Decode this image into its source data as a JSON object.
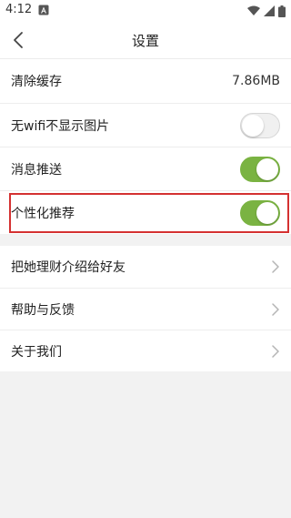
{
  "status_bar": {
    "time": "4:12"
  },
  "header": {
    "title": "设置"
  },
  "settings": {
    "cache": {
      "label": "清除缓存",
      "value": "7.86MB"
    },
    "no_wifi_images": {
      "label": "无wifi不显示图片",
      "state": "off"
    },
    "push_notifications": {
      "label": "消息推送",
      "state": "on"
    },
    "personalized": {
      "label": "个性化推荐",
      "state": "on"
    }
  },
  "links": {
    "recommend": {
      "label": "把她理财介绍给好友"
    },
    "help": {
      "label": "帮助与反馈"
    },
    "about": {
      "label": "关于我们"
    }
  },
  "colors": {
    "toggle_on": "#7ab342",
    "highlight": "#d43131"
  }
}
